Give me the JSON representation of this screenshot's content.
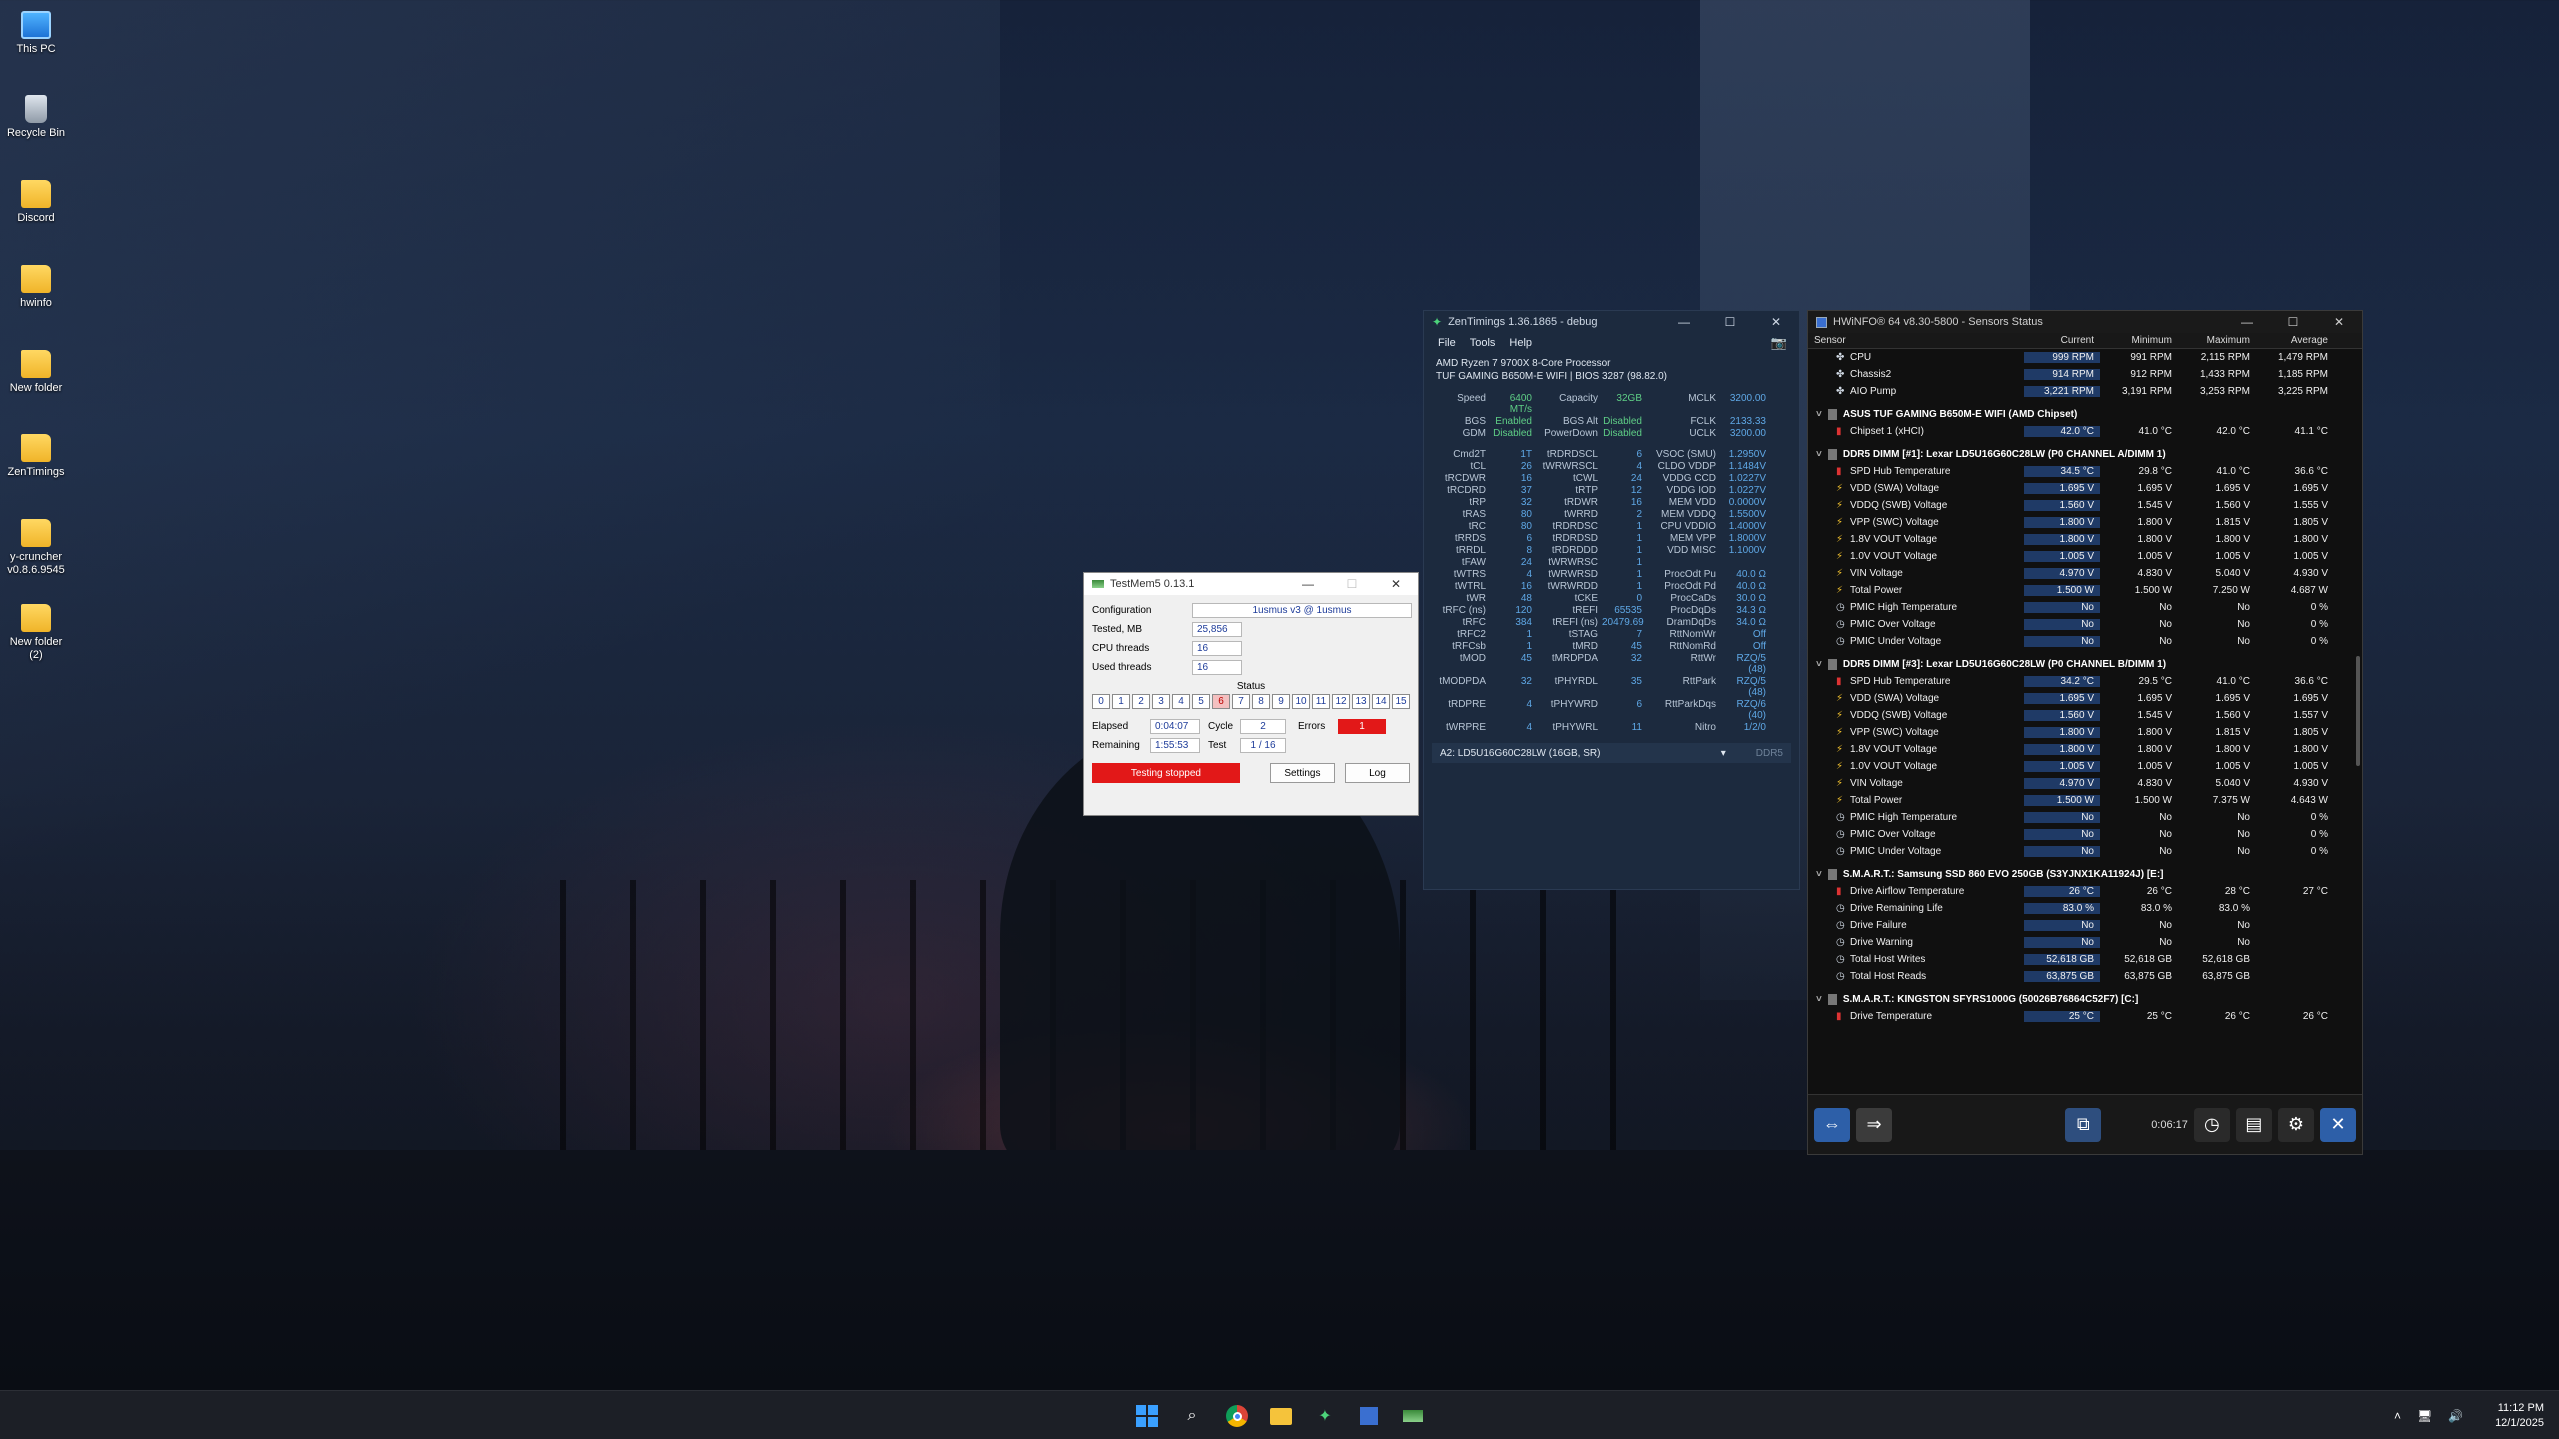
{
  "desktop": {
    "icons": [
      {
        "label": "This PC",
        "icon": "pc-icon"
      },
      {
        "label": "Recycle Bin",
        "icon": "recycle-bin-icon"
      },
      {
        "label": "Discord",
        "icon": "folder-icon"
      },
      {
        "label": "hwinfo",
        "icon": "folder-icon"
      },
      {
        "label": "New folder",
        "icon": "folder-icon"
      },
      {
        "label": "ZenTimings",
        "icon": "folder-icon"
      },
      {
        "label": "y-cruncher v0.8.6.9545",
        "icon": "folder-icon"
      },
      {
        "label": "New folder (2)",
        "icon": "folder-icon"
      }
    ]
  },
  "zentimings": {
    "title": "ZenTimings 1.36.1865 - debug",
    "menu": [
      "File",
      "Tools",
      "Help"
    ],
    "cpu": "AMD Ryzen 7 9700X 8-Core Processor",
    "board": "TUF GAMING B650M-E WIFI | BIOS 3287 (98.82.0)",
    "top_rows": [
      [
        "Speed",
        "6400 MT/s",
        "Capacity",
        "32GB",
        "MCLK",
        "3200.00"
      ],
      [
        "BGS",
        "Enabled",
        "BGS Alt",
        "Disabled",
        "FCLK",
        "2133.33"
      ],
      [
        "GDM",
        "Disabled",
        "PowerDown",
        "Disabled",
        "UCLK",
        "3200.00"
      ]
    ],
    "timing_rows": [
      [
        "Cmd2T",
        "1T",
        "tRDRDSCL",
        "6",
        "VSOC (SMU)",
        "1.2950V"
      ],
      [
        "tCL",
        "26",
        "tWRWRSCL",
        "4",
        "CLDO VDDP",
        "1.1484V"
      ],
      [
        "tRCDWR",
        "16",
        "tCWL",
        "24",
        "VDDG CCD",
        "1.0227V"
      ],
      [
        "tRCDRD",
        "37",
        "tRTP",
        "12",
        "VDDG IOD",
        "1.0227V"
      ],
      [
        "tRP",
        "32",
        "tRDWR",
        "16",
        "MEM VDD",
        "0.0000V"
      ],
      [
        "tRAS",
        "80",
        "tWRRD",
        "2",
        "MEM VDDQ",
        "1.5500V"
      ],
      [
        "tRC",
        "80",
        "tRDRDSC",
        "1",
        "CPU VDDIO",
        "1.4000V"
      ],
      [
        "tRRDS",
        "6",
        "tRDRDSD",
        "1",
        "MEM VPP",
        "1.8000V"
      ],
      [
        "tRRDL",
        "8",
        "tRDRDDD",
        "1",
        "VDD MISC",
        "1.1000V"
      ],
      [
        "tFAW",
        "24",
        "tWRWRSC",
        "1",
        "",
        ""
      ],
      [
        "tWTRS",
        "4",
        "tWRWRSD",
        "1",
        "ProcOdt Pu",
        "40.0 Ω"
      ],
      [
        "tWTRL",
        "16",
        "tWRWRDD",
        "1",
        "ProcOdt Pd",
        "40.0 Ω"
      ],
      [
        "tWR",
        "48",
        "tCKE",
        "0",
        "ProcCaDs",
        "30.0 Ω"
      ],
      [
        "tRFC (ns)",
        "120",
        "tREFI",
        "65535",
        "ProcDqDs",
        "34.3 Ω"
      ],
      [
        "tRFC",
        "384",
        "tREFI (ns)",
        "20479.69",
        "DramDqDs",
        "34.0 Ω"
      ],
      [
        "tRFC2",
        "1",
        "tSTAG",
        "7",
        "RttNomWr",
        "Off"
      ],
      [
        "tRFCsb",
        "1",
        "tMRD",
        "45",
        "RttNomRd",
        "Off"
      ],
      [
        "tMOD",
        "45",
        "tMRDPDA",
        "32",
        "RttWr",
        "RZQ/5 (48)"
      ],
      [
        "tMODPDA",
        "32",
        "tPHYRDL",
        "35",
        "RttPark",
        "RZQ/5 (48)"
      ],
      [
        "tRDPRE",
        "4",
        "tPHYWRD",
        "6",
        "RttParkDqs",
        "RZQ/6 (40)"
      ],
      [
        "tWRPRE",
        "4",
        "tPHYWRL",
        "11",
        "Nitro",
        "1/2/0"
      ]
    ],
    "dimm_select": "A2: LD5U16G60C28LW (16GB, SR)",
    "mem_type": "DDR5"
  },
  "testmem5": {
    "title": "TestMem5  0.13.1",
    "configuration_label": "Configuration",
    "configuration_value": "1usmus v3 @ 1usmus",
    "tested_label": "Tested, MB",
    "tested_value": "25,856",
    "cpu_threads_label": "CPU threads",
    "cpu_threads_value": "16",
    "used_threads_label": "Used threads",
    "used_threads_value": "16",
    "status_label": "Status",
    "cells": [
      "0",
      "1",
      "2",
      "3",
      "4",
      "5",
      "6",
      "7",
      "8",
      "9",
      "10",
      "11",
      "12",
      "13",
      "14",
      "15"
    ],
    "error_cell": "6",
    "elapsed_label": "Elapsed",
    "elapsed_value": "0:04:07",
    "cycle_label": "Cycle",
    "cycle_value": "2",
    "errors_label": "Errors",
    "errors_value": "1",
    "remaining_label": "Remaining",
    "remaining_value": "1:55:53",
    "test_label": "Test",
    "test_value": "1 / 16",
    "stop_button": "Testing stopped",
    "settings_button": "Settings",
    "log_button": "Log",
    "colors": {
      "stop": "#e21818",
      "error": "#e21818"
    }
  },
  "hwinfo": {
    "title": "HWiNFO® 64 v8.30-5800 - Sensors Status",
    "columns": [
      "Sensor",
      "Current",
      "Minimum",
      "Maximum",
      "Average"
    ],
    "sections": [
      {
        "title": "",
        "rows": [
          {
            "icon": "fan-icon",
            "name": "CPU",
            "cur": "999 RPM",
            "min": "991 RPM",
            "max": "2,115 RPM",
            "avg": "1,479 RPM"
          },
          {
            "icon": "fan-icon",
            "name": "Chassis2",
            "cur": "914 RPM",
            "min": "912 RPM",
            "max": "1,433 RPM",
            "avg": "1,185 RPM"
          },
          {
            "icon": "fan-icon",
            "name": "AIO Pump",
            "cur": "3,221 RPM",
            "min": "3,191 RPM",
            "max": "3,253 RPM",
            "avg": "3,225 RPM"
          }
        ]
      },
      {
        "title": "ASUS TUF GAMING B650M-E WIFI (AMD Chipset)",
        "rows": [
          {
            "icon": "thermo-icon",
            "name": "Chipset 1 (xHCI)",
            "cur": "42.0 °C",
            "min": "41.0 °C",
            "max": "42.0 °C",
            "avg": "41.1 °C"
          }
        ]
      },
      {
        "title": "DDR5 DIMM [#1]: Lexar LD5U16G60C28LW (P0 CHANNEL A/DIMM 1)",
        "rows": [
          {
            "icon": "thermo-icon",
            "name": "SPD Hub Temperature",
            "cur": "34.5 °C",
            "min": "29.8 °C",
            "max": "41.0 °C",
            "avg": "36.6 °C"
          },
          {
            "icon": "bolt-icon",
            "name": "VDD (SWA) Voltage",
            "cur": "1.695 V",
            "min": "1.695 V",
            "max": "1.695 V",
            "avg": "1.695 V"
          },
          {
            "icon": "bolt-icon",
            "name": "VDDQ (SWB) Voltage",
            "cur": "1.560 V",
            "min": "1.545 V",
            "max": "1.560 V",
            "avg": "1.555 V"
          },
          {
            "icon": "bolt-icon",
            "name": "VPP (SWC) Voltage",
            "cur": "1.800 V",
            "min": "1.800 V",
            "max": "1.815 V",
            "avg": "1.805 V"
          },
          {
            "icon": "bolt-icon",
            "name": "1.8V VOUT Voltage",
            "cur": "1.800 V",
            "min": "1.800 V",
            "max": "1.800 V",
            "avg": "1.800 V"
          },
          {
            "icon": "bolt-icon",
            "name": "1.0V VOUT Voltage",
            "cur": "1.005 V",
            "min": "1.005 V",
            "max": "1.005 V",
            "avg": "1.005 V"
          },
          {
            "icon": "bolt-icon",
            "name": "VIN Voltage",
            "cur": "4.970 V",
            "min": "4.830 V",
            "max": "5.040 V",
            "avg": "4.930 V"
          },
          {
            "icon": "bolt-icon",
            "name": "Total Power",
            "cur": "1.500 W",
            "min": "1.500 W",
            "max": "7.250 W",
            "avg": "4.687 W"
          },
          {
            "icon": "clock-icon",
            "name": "PMIC High Temperature",
            "cur": "No",
            "min": "No",
            "max": "No",
            "avg": "0 %"
          },
          {
            "icon": "clock-icon",
            "name": "PMIC Over Voltage",
            "cur": "No",
            "min": "No",
            "max": "No",
            "avg": "0 %"
          },
          {
            "icon": "clock-icon",
            "name": "PMIC Under Voltage",
            "cur": "No",
            "min": "No",
            "max": "No",
            "avg": "0 %"
          }
        ]
      },
      {
        "title": "DDR5 DIMM [#3]: Lexar LD5U16G60C28LW (P0 CHANNEL B/DIMM 1)",
        "rows": [
          {
            "icon": "thermo-icon",
            "name": "SPD Hub Temperature",
            "cur": "34.2 °C",
            "min": "29.5 °C",
            "max": "41.0 °C",
            "avg": "36.6 °C"
          },
          {
            "icon": "bolt-icon",
            "name": "VDD (SWA) Voltage",
            "cur": "1.695 V",
            "min": "1.695 V",
            "max": "1.695 V",
            "avg": "1.695 V"
          },
          {
            "icon": "bolt-icon",
            "name": "VDDQ (SWB) Voltage",
            "cur": "1.560 V",
            "min": "1.545 V",
            "max": "1.560 V",
            "avg": "1.557 V"
          },
          {
            "icon": "bolt-icon",
            "name": "VPP (SWC) Voltage",
            "cur": "1.800 V",
            "min": "1.800 V",
            "max": "1.815 V",
            "avg": "1.805 V"
          },
          {
            "icon": "bolt-icon",
            "name": "1.8V VOUT Voltage",
            "cur": "1.800 V",
            "min": "1.800 V",
            "max": "1.800 V",
            "avg": "1.800 V"
          },
          {
            "icon": "bolt-icon",
            "name": "1.0V VOUT Voltage",
            "cur": "1.005 V",
            "min": "1.005 V",
            "max": "1.005 V",
            "avg": "1.005 V"
          },
          {
            "icon": "bolt-icon",
            "name": "VIN Voltage",
            "cur": "4.970 V",
            "min": "4.830 V",
            "max": "5.040 V",
            "avg": "4.930 V"
          },
          {
            "icon": "bolt-icon",
            "name": "Total Power",
            "cur": "1.500 W",
            "min": "1.500 W",
            "max": "7.375 W",
            "avg": "4.643 W"
          },
          {
            "icon": "clock-icon",
            "name": "PMIC High Temperature",
            "cur": "No",
            "min": "No",
            "max": "No",
            "avg": "0 %"
          },
          {
            "icon": "clock-icon",
            "name": "PMIC Over Voltage",
            "cur": "No",
            "min": "No",
            "max": "No",
            "avg": "0 %"
          },
          {
            "icon": "clock-icon",
            "name": "PMIC Under Voltage",
            "cur": "No",
            "min": "No",
            "max": "No",
            "avg": "0 %"
          }
        ]
      },
      {
        "title": "S.M.A.R.T.: Samsung SSD 860 EVO 250GB (S3YJNX1KA11924J) [E:]",
        "rows": [
          {
            "icon": "thermo-icon",
            "name": "Drive Airflow Temperature",
            "cur": "26 °C",
            "min": "26 °C",
            "max": "28 °C",
            "avg": "27 °C"
          },
          {
            "icon": "clock-icon",
            "name": "Drive Remaining Life",
            "cur": "83.0 %",
            "min": "83.0 %",
            "max": "83.0 %",
            "avg": ""
          },
          {
            "icon": "clock-icon",
            "name": "Drive Failure",
            "cur": "No",
            "min": "No",
            "max": "No",
            "avg": ""
          },
          {
            "icon": "clock-icon",
            "name": "Drive Warning",
            "cur": "No",
            "min": "No",
            "max": "No",
            "avg": ""
          },
          {
            "icon": "clock-icon",
            "name": "Total Host Writes",
            "cur": "52,618 GB",
            "min": "52,618 GB",
            "max": "52,618 GB",
            "avg": ""
          },
          {
            "icon": "clock-icon",
            "name": "Total Host Reads",
            "cur": "63,875 GB",
            "min": "63,875 GB",
            "max": "63,875 GB",
            "avg": ""
          }
        ]
      },
      {
        "title": "S.M.A.R.T.: KINGSTON SFYRS1000G (50026B76864C52F7) [C:]",
        "rows": [
          {
            "icon": "thermo-icon",
            "name": "Drive Temperature",
            "cur": "25 °C",
            "min": "25 °C",
            "max": "26 °C",
            "avg": "26 °C"
          }
        ]
      }
    ],
    "timer": "0:06:17"
  },
  "taskbar": {
    "time": "11:12 PM",
    "date": "12/1/2025"
  }
}
